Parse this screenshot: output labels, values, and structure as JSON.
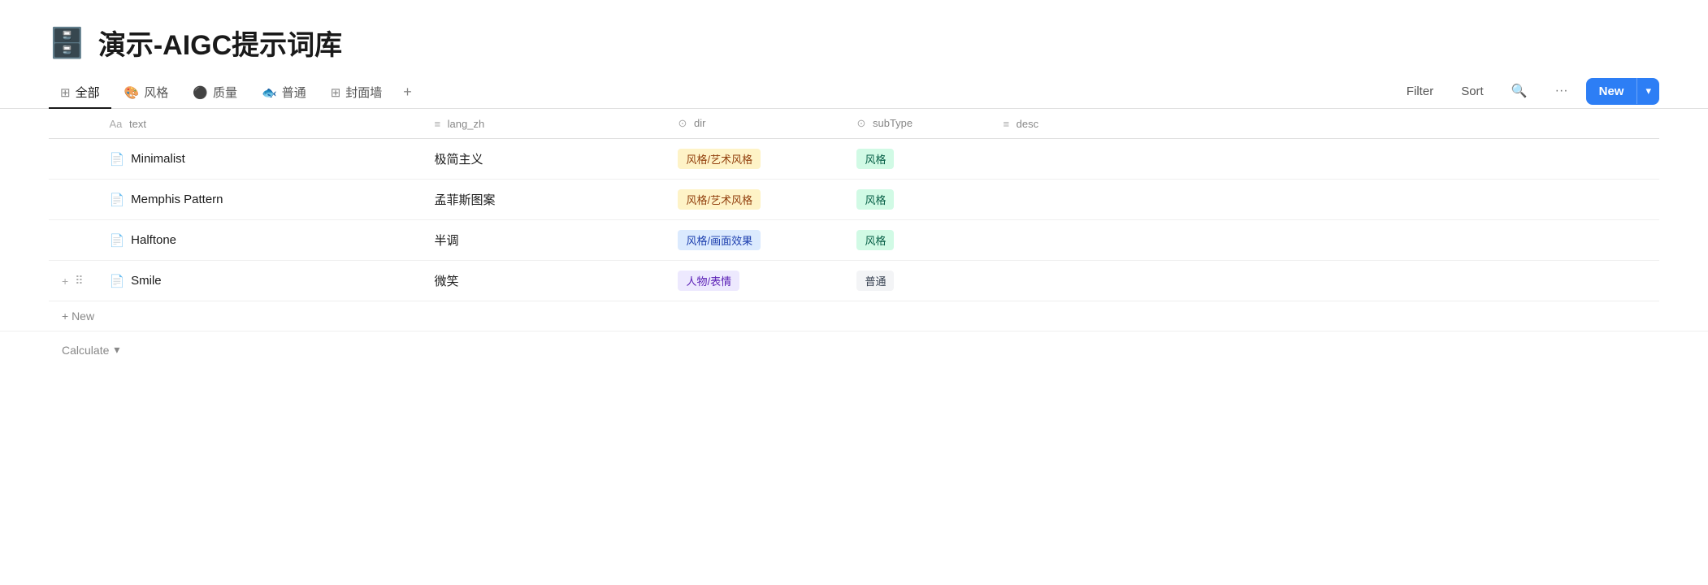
{
  "page": {
    "title": "演示-AIGC提示词库",
    "icon": "🗄️"
  },
  "tabs": [
    {
      "id": "all",
      "icon": "⊞",
      "label": "全部",
      "active": true
    },
    {
      "id": "style",
      "icon": "🎨",
      "label": "风格",
      "active": false
    },
    {
      "id": "quality",
      "icon": "⚫",
      "label": "质量",
      "active": false
    },
    {
      "id": "normal",
      "icon": "🐟",
      "label": "普通",
      "active": false
    },
    {
      "id": "cover",
      "icon": "⊞",
      "label": "封面墙",
      "active": false
    }
  ],
  "toolbar": {
    "filter_label": "Filter",
    "sort_label": "Sort",
    "new_label": "New",
    "new_arrow": "▾"
  },
  "columns": [
    {
      "id": "text",
      "icon": "Aa",
      "label": "text"
    },
    {
      "id": "lang_zh",
      "icon": "≡",
      "label": "lang_zh"
    },
    {
      "id": "dir",
      "icon": "⊙",
      "label": "dir"
    },
    {
      "id": "subType",
      "icon": "⊙",
      "label": "subType"
    },
    {
      "id": "desc",
      "icon": "≡",
      "label": "desc"
    }
  ],
  "rows": [
    {
      "text": "Minimalist",
      "lang_zh": "极简主义",
      "dir": "风格/艺术风格",
      "dir_tag": "tag-yellow",
      "subType": "风格",
      "subType_tag": "tag-green",
      "desc": "",
      "has_controls": false
    },
    {
      "text": "Memphis Pattern",
      "lang_zh": "孟菲斯图案",
      "dir": "风格/艺术风格",
      "dir_tag": "tag-yellow",
      "subType": "风格",
      "subType_tag": "tag-green",
      "desc": "",
      "has_controls": false
    },
    {
      "text": "Halftone",
      "lang_zh": "半调",
      "dir": "风格/画面效果",
      "dir_tag": "tag-blue",
      "subType": "风格",
      "subType_tag": "tag-green",
      "desc": "",
      "has_controls": false
    },
    {
      "text": "Smile",
      "lang_zh": "微笑",
      "dir": "人物/表情",
      "dir_tag": "tag-purple",
      "subType": "普通",
      "subType_tag": "tag-gray",
      "desc": "",
      "has_controls": true
    }
  ],
  "footer": {
    "new_label": "+ New",
    "calculate_label": "Calculate",
    "calculate_arrow": "▾"
  }
}
